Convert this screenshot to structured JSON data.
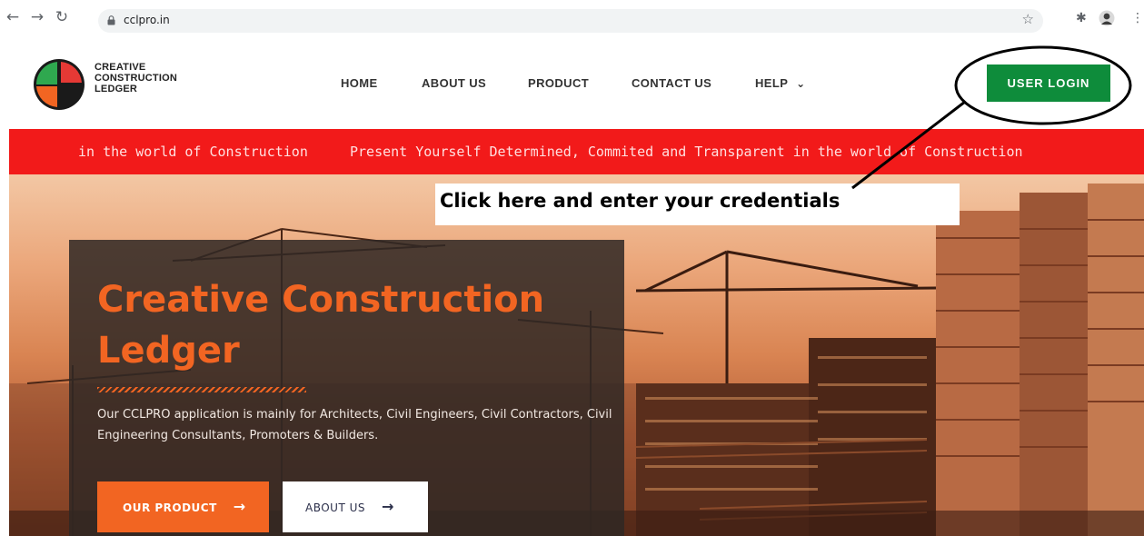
{
  "browser": {
    "back_icon": "arrow-left-icon",
    "forward_icon": "arrow-right-icon",
    "reload_icon": "reload-icon",
    "lock_icon": "lock-icon",
    "url": "cclpro.in",
    "bookmark_icon": "star-icon",
    "extensions_icon": "puzzle-icon",
    "menu_icon": "kebab-icon"
  },
  "brand": {
    "line1": "CREATIVE",
    "line2": "CONSTRUCTION",
    "line3": "LEDGER",
    "logo_colors": [
      "#2fa84f",
      "#e53935",
      "#f26522",
      "#1a1a1a"
    ]
  },
  "nav": {
    "home": "HOME",
    "about": "ABOUT US",
    "product": "PRODUCT",
    "contact": "CONTACT US",
    "help": "HELP",
    "help_caret": "⌄",
    "login": "USER LOGIN"
  },
  "ticker": {
    "text_left": "in the world of Construction",
    "text_main": "Present Yourself Determined, Commited and Transparent in the world of Construction"
  },
  "hero": {
    "title": "Creative Construction Ledger",
    "description": "Our CCLPRO application is mainly for Architects, Civil Engineers, Civil Contractors, Civil Engineering Consultants, Promoters & Builders.",
    "primary_button": "OUR PRODUCT",
    "secondary_button": "ABOUT US",
    "button_arrow": "→"
  },
  "annotation": {
    "text": "Click here and enter your credentials"
  },
  "colors": {
    "accent_orange": "#f26522",
    "login_green": "#0e8c3b",
    "ticker_red": "#f21a1a",
    "panel_dark": "#302824"
  }
}
